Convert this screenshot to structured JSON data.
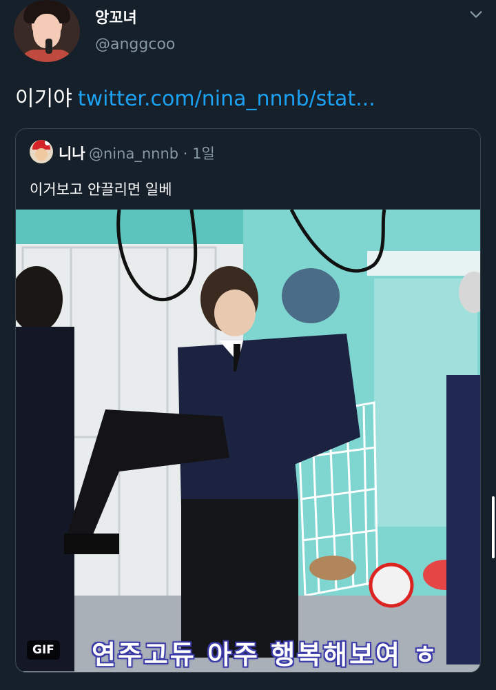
{
  "author": {
    "display_name": "앙꼬녀",
    "handle": "@anggcoo"
  },
  "tweet": {
    "text": "이기야",
    "link_text": "twitter.com/nina_nnnb/stat..."
  },
  "quoted_tweet": {
    "display_name": "니나",
    "handle_time": "@nina_nnnb · 1일",
    "text": "이거보고 안끌리면 일베",
    "media": {
      "badge": "GIF",
      "caption": "연주고듀 아주 행복해보여   ㅎ"
    }
  },
  "colors": {
    "background": "#15202b",
    "link": "#1da1f2",
    "secondary_text": "#8899a6",
    "border": "#38444d"
  },
  "icons": {
    "menu": "chevron-down-icon"
  }
}
